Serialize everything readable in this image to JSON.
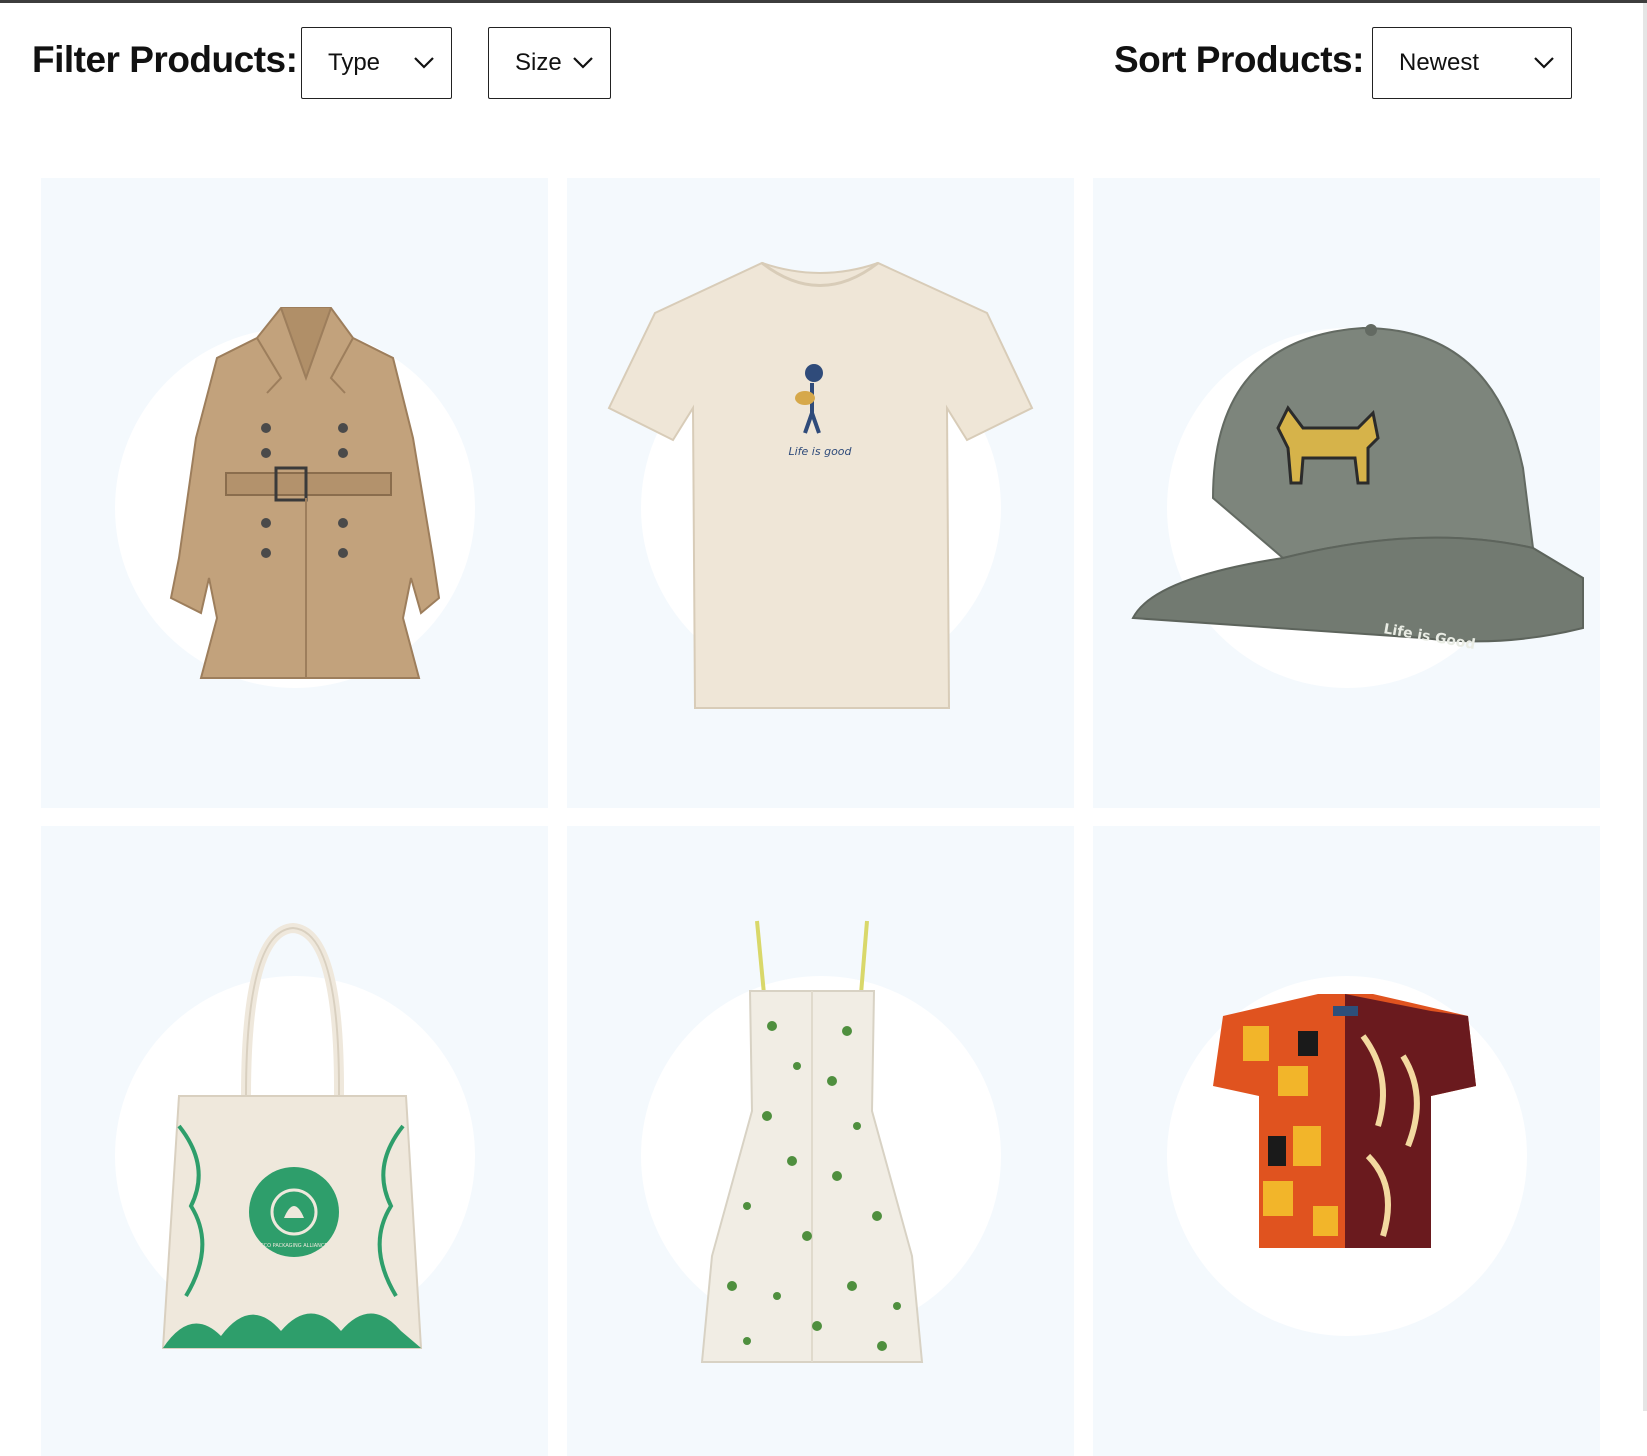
{
  "filters": {
    "label": "Filter Products:",
    "type_select": {
      "value": "Type"
    },
    "size_select": {
      "value": "Size"
    }
  },
  "sort": {
    "label": "Sort Products:",
    "select": {
      "value": "Newest"
    }
  },
  "products": [
    {
      "name": "trench coat",
      "colors": {
        "main": "#c2a27c",
        "shade": "#9d7e5c"
      }
    },
    {
      "name": "tee",
      "print_text": "Life is good",
      "colors": {
        "main": "#efe6d7"
      }
    },
    {
      "name": "cap",
      "print_text": "Life is Good",
      "colors": {
        "main": "#7d857c",
        "patch": "#d6b34a"
      }
    },
    {
      "name": "tote",
      "seal_text": "ECO PACKAGING ALLIANCE",
      "colors": {
        "main": "#efe8dc",
        "accent": "#2e9e6b"
      }
    },
    {
      "name": "dress",
      "colors": {
        "main": "#f1ede4",
        "print": "#4f8f3e"
      }
    },
    {
      "name": "shirt",
      "colors": {
        "orange": "#e0531f",
        "yellow": "#f2b52a",
        "maroon": "#6a1a1e"
      }
    }
  ]
}
